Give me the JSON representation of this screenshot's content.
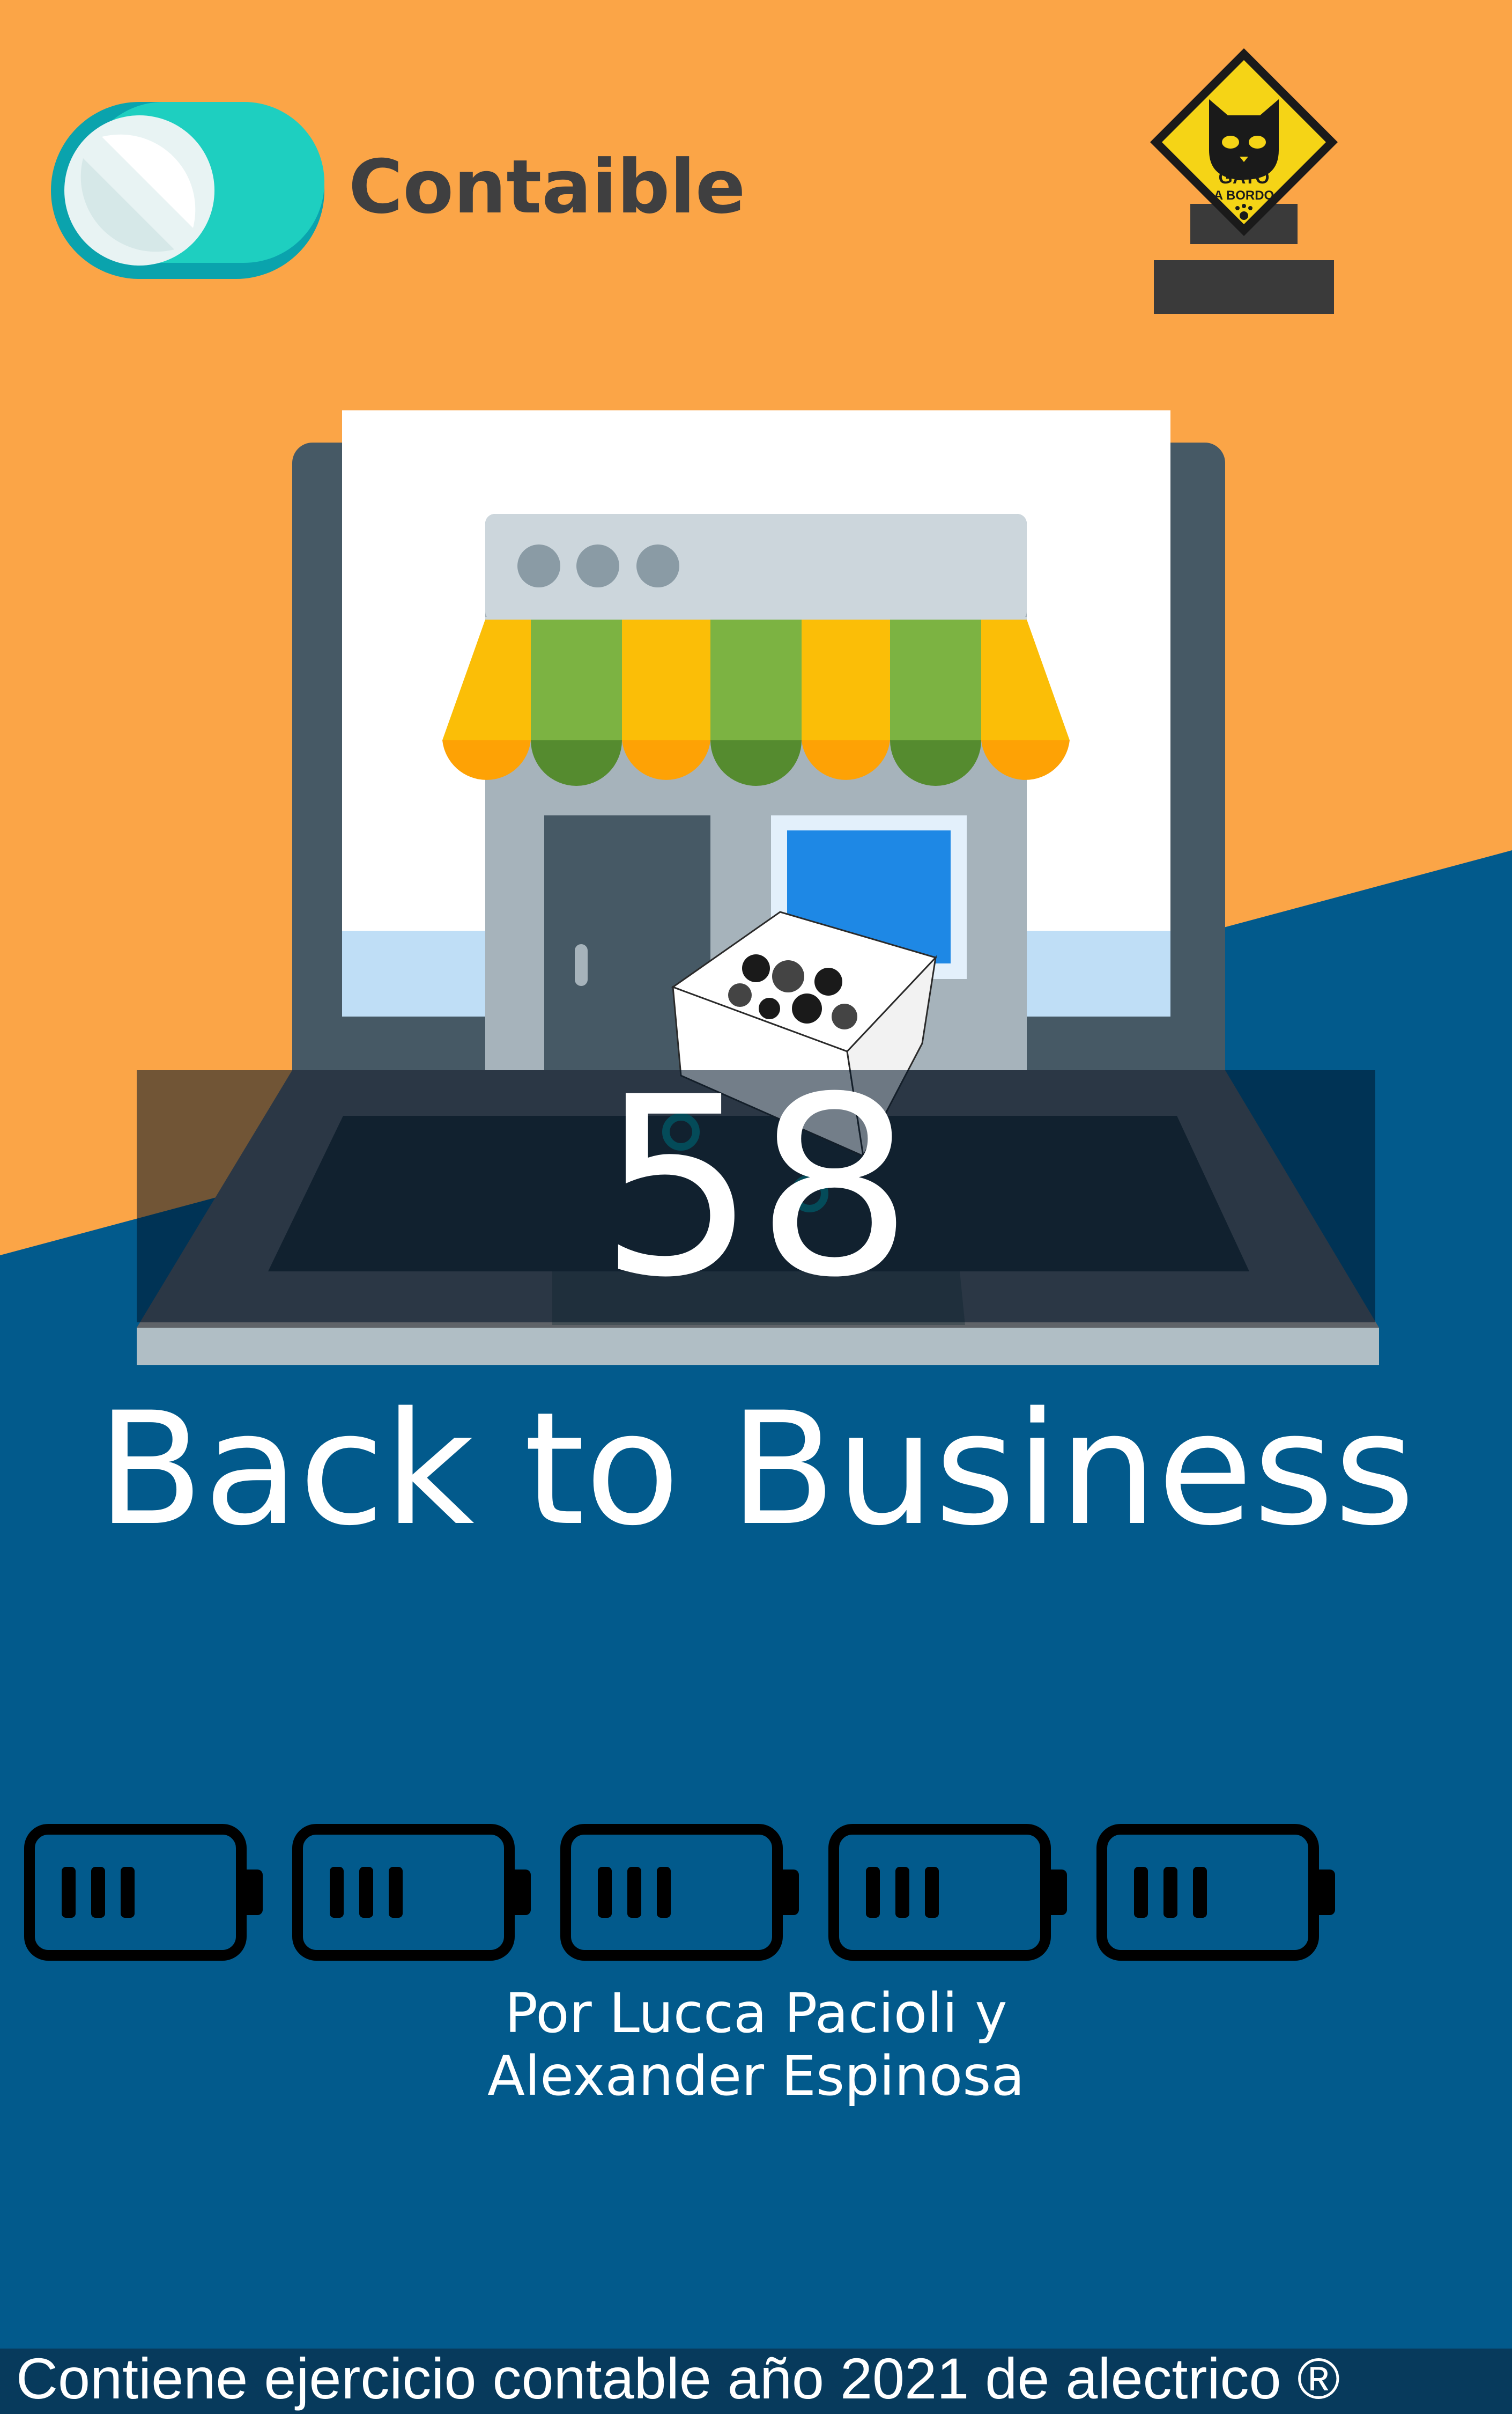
{
  "brand": {
    "name": "Contaible"
  },
  "badge": {
    "line1": "GATO",
    "line2": "A BORDO",
    "icon": "cat-icon"
  },
  "cover": {
    "issue_number": "58",
    "title": "Back to Business",
    "authors_line1": "Por Lucca Pacioli y",
    "authors_line2": "Alexander Espinosa"
  },
  "footer": {
    "text": "Contiene ejercicio contable año 2021 de alectrico ®"
  },
  "batteries": {
    "count": 5,
    "icon": "battery-icon"
  },
  "colors": {
    "orange": "#fba547",
    "blue": "#025a8c",
    "teal": "#1ecfc0",
    "text_dark": "#3f3f40",
    "awning_yellow": "#fbbe07",
    "awning_green": "#7cb342"
  }
}
